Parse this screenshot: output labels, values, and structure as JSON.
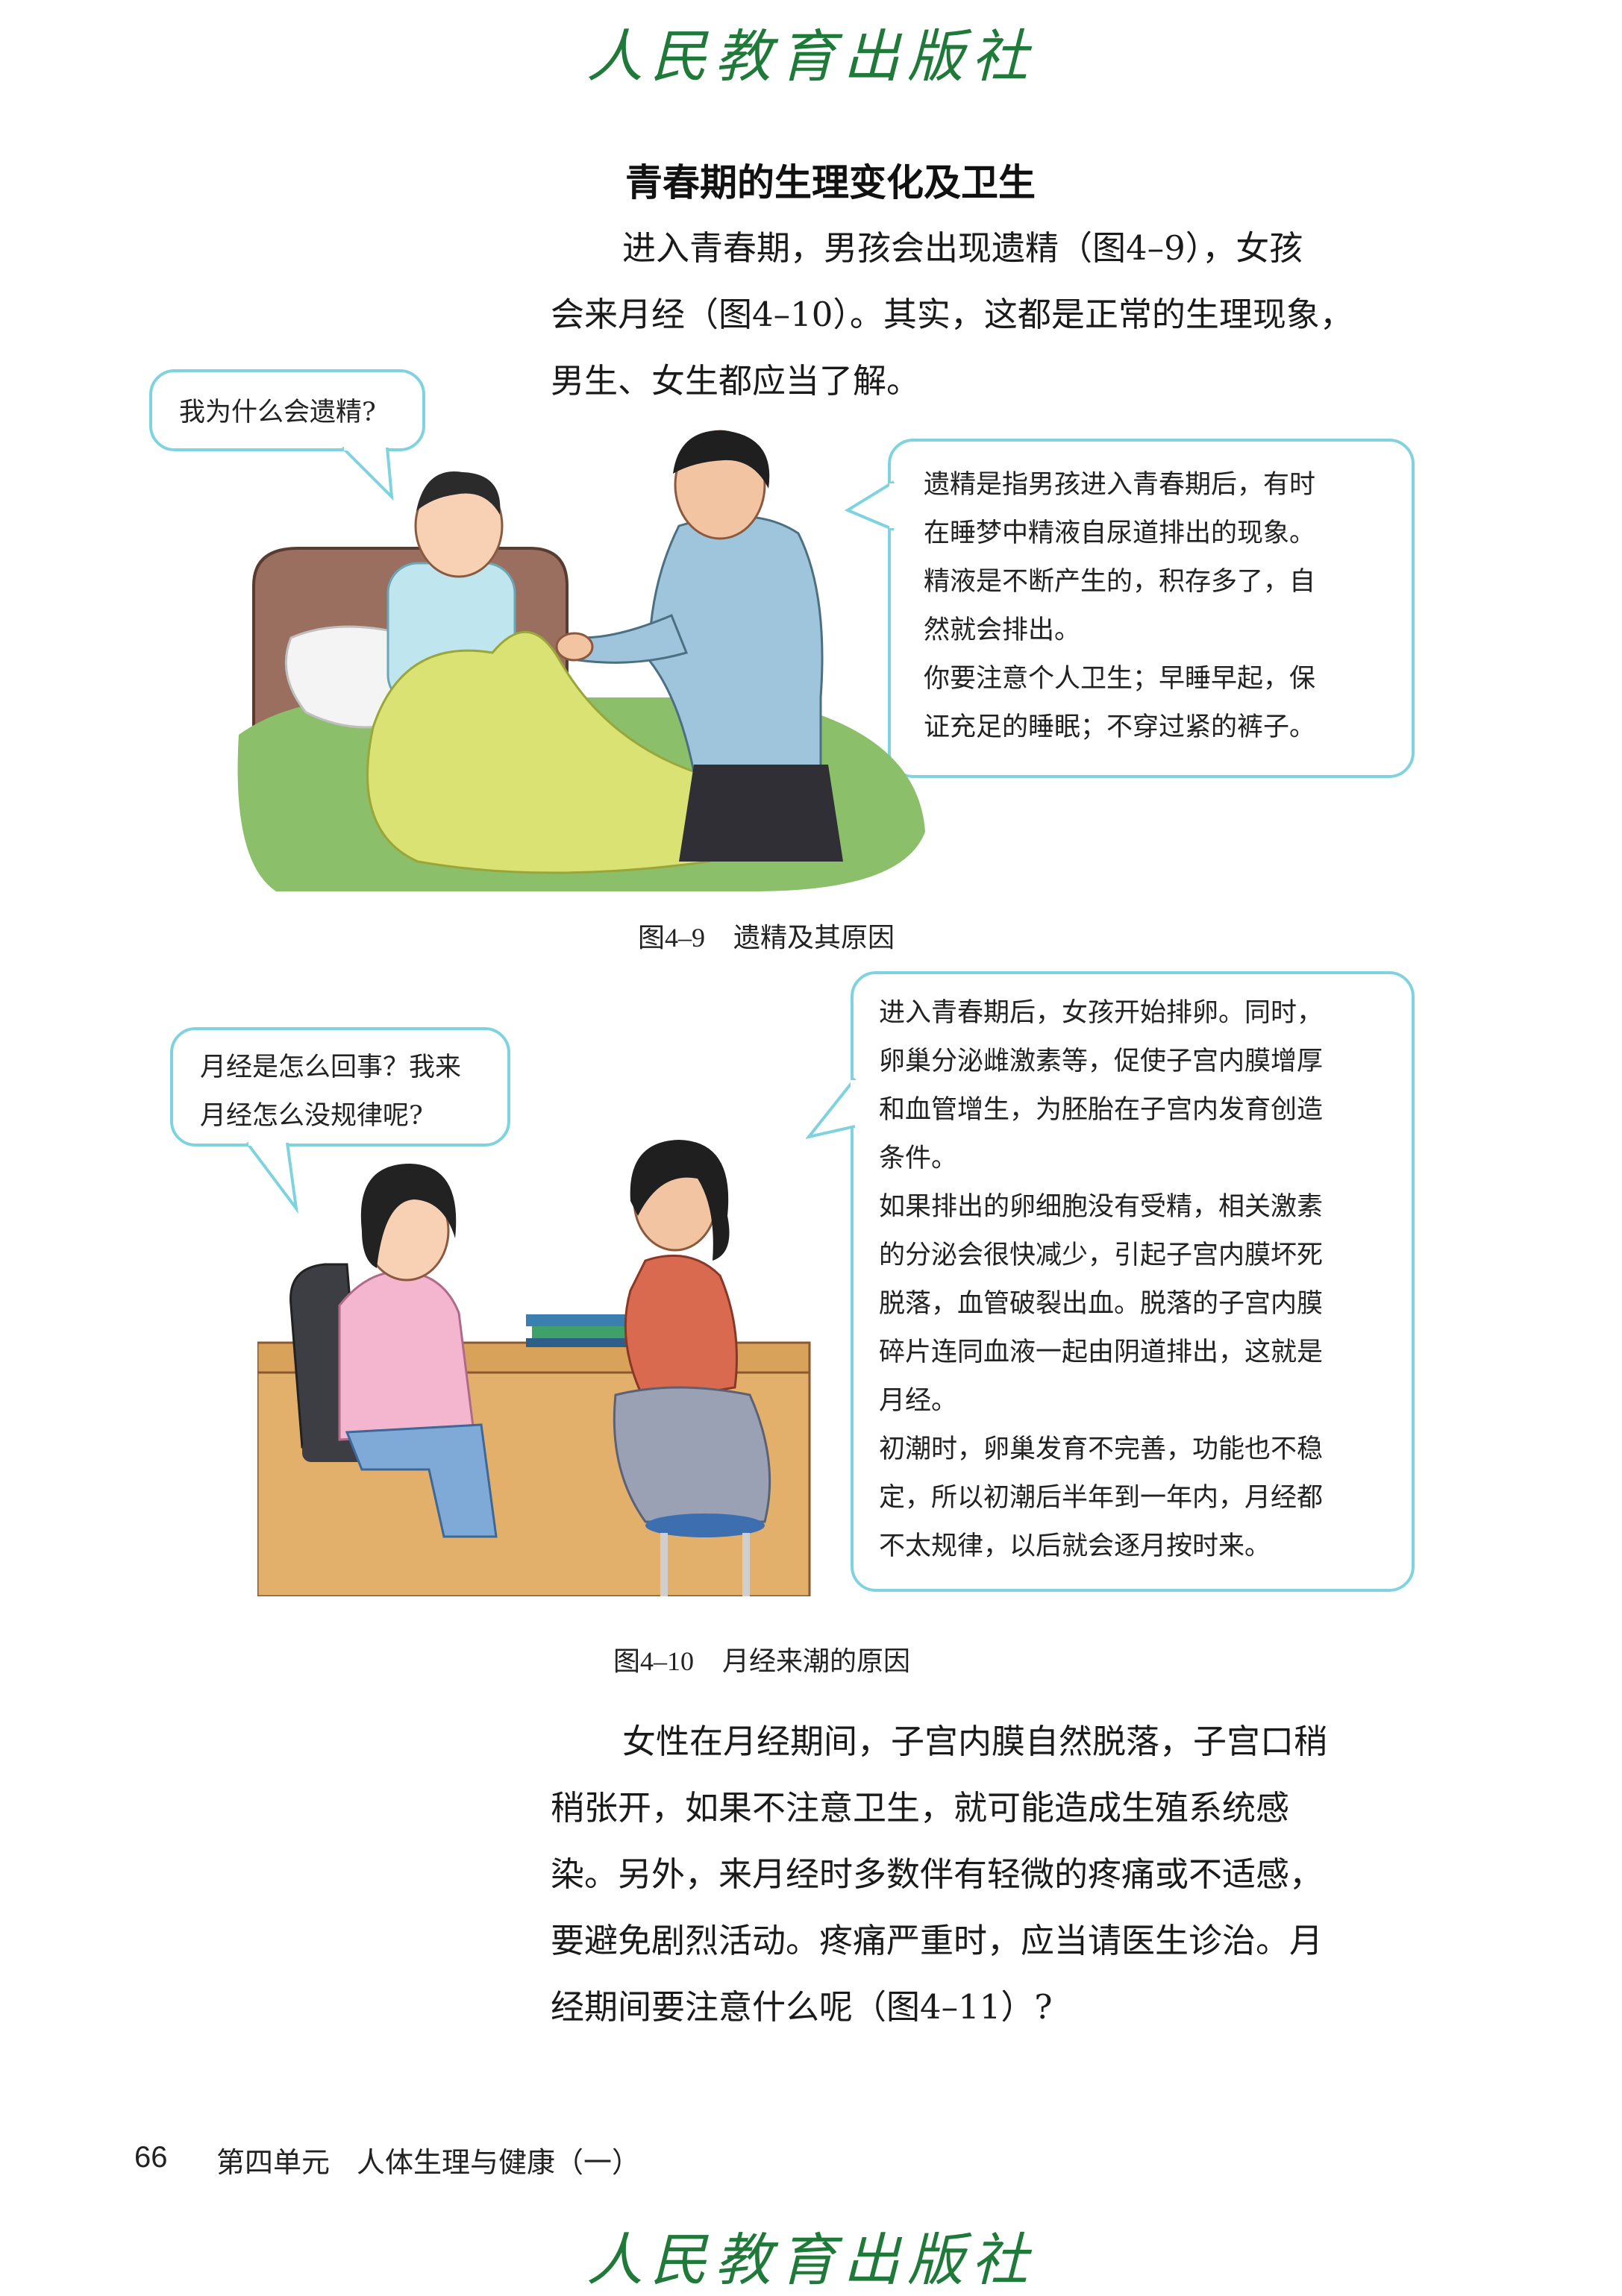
{
  "publisher": "人民教育出版社",
  "section_title": "青春期的生理变化及卫生",
  "intro_paragraph": [
    "进入青春期，男孩会出现遗精（图4–9），女孩",
    "会来月经（图4–10）。其实，这都是正常的生理现象，",
    "男生、女生都应当了解。"
  ],
  "figure1": {
    "boy_question": "我为什么会遗精?",
    "father_answer": [
      "遗精是指男孩进入青春期后，有时",
      "在睡梦中精液自尿道排出的现象。",
      "精液是不断产生的，积存多了，自",
      "然就会排出。",
      "你要注意个人卫生；早睡早起，保",
      "证充足的睡眠；不穿过紧的裤子。"
    ],
    "caption_num": "图4–9",
    "caption_text": "遗精及其原因"
  },
  "figure2": {
    "girl_question": [
      "月经是怎么回事？我来",
      "月经怎么没规律呢?"
    ],
    "mother_answer": [
      "进入青春期后，女孩开始排卵。同时，",
      "卵巢分泌雌激素等，促使子宫内膜增厚",
      "和血管增生，为胚胎在子宫内发育创造",
      "条件。",
      "如果排出的卵细胞没有受精，相关激素",
      "的分泌会很快减少，引起子宫内膜坏死",
      "脱落，血管破裂出血。脱落的子宫内膜",
      "碎片连同血液一起由阴道排出，这就是",
      "月经。",
      "初潮时，卵巢发育不完善，功能也不稳",
      "定，所以初潮后半年到一年内，月经都",
      "不太规律，以后就会逐月按时来。"
    ],
    "caption_num": "图4–10",
    "caption_text": "月经来潮的原因"
  },
  "closing_paragraph": [
    "女性在月经期间，子宫内膜自然脱落，子宫口稍",
    "稍张开，如果不注意卫生，就可能造成生殖系统感",
    "染。另外，来月经时多数伴有轻微的疼痛或不适感，",
    "要避免剧烈活动。疼痛严重时，应当请医生诊治。月",
    "经期间要注意什么呢（图4–11）?"
  ],
  "footer": {
    "page_number": "66",
    "unit": "第四单元",
    "unit_title": "人体生理与健康（一）"
  },
  "colors": {
    "bubble_border": "#7fd3df",
    "publisher_green": "#1f7a3a"
  }
}
